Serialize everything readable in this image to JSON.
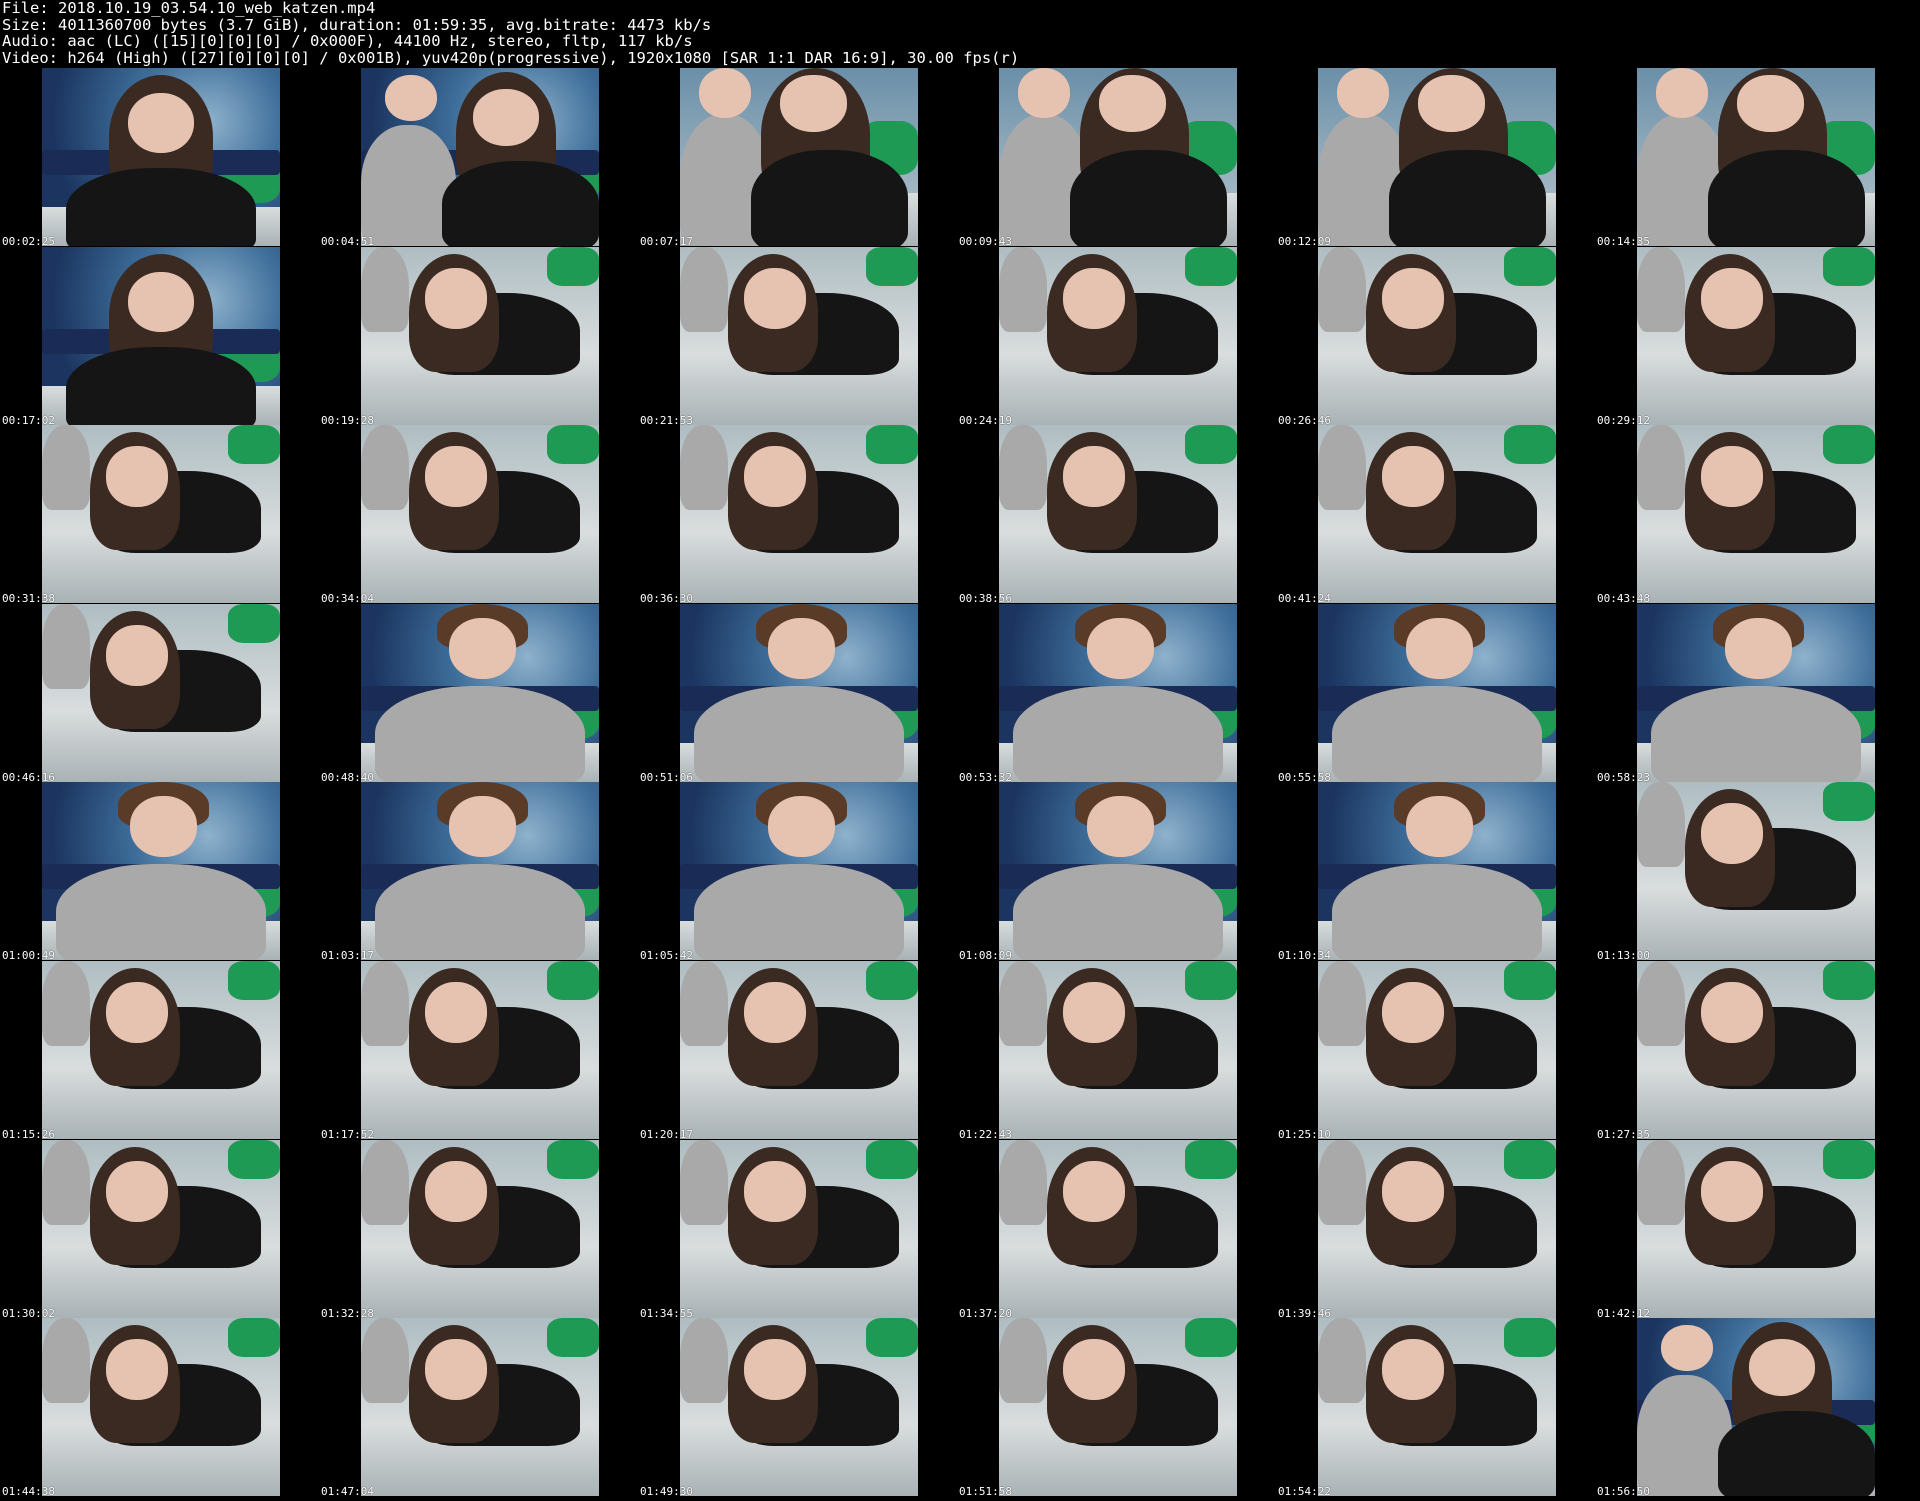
{
  "header": {
    "file": "File: 2018.10.19_03.54.10_web_katzen.mp4",
    "size": "Size: 4011360700 bytes (3.7 GiB), duration: 01:59:35, avg.bitrate: 4473 kb/s",
    "audio": "Audio: aac (LC) ([15][0][0][0] / 0x000F), 44100 Hz, stereo, fltp, 117 kb/s",
    "video": "Video: h264 (High) ([27][0][0][0] / 0x001B), yuv420p(progressive), 1920x1080 [SAR 1:1 DAR 16:9], 30.00 fps(r)"
  },
  "thumbnails": [
    {
      "time": "00:02:25",
      "scene": "sky-girl"
    },
    {
      "time": "00:04:51",
      "scene": "sky-couple"
    },
    {
      "time": "00:07:17",
      "scene": "couple"
    },
    {
      "time": "00:09:43",
      "scene": "couple"
    },
    {
      "time": "00:12:09",
      "scene": "couple"
    },
    {
      "time": "00:14:35",
      "scene": "couple"
    },
    {
      "time": "00:17:02",
      "scene": "sky-girl"
    },
    {
      "time": "00:19:28",
      "scene": "bed-girl"
    },
    {
      "time": "00:21:53",
      "scene": "bed-girl"
    },
    {
      "time": "00:24:19",
      "scene": "bed-girl"
    },
    {
      "time": "00:26:46",
      "scene": "bed-girl"
    },
    {
      "time": "00:29:12",
      "scene": "bed-girl"
    },
    {
      "time": "00:31:38",
      "scene": "bed-girl"
    },
    {
      "time": "00:34:04",
      "scene": "bed-girl"
    },
    {
      "time": "00:36:30",
      "scene": "bed-girl"
    },
    {
      "time": "00:38:56",
      "scene": "bed-girl"
    },
    {
      "time": "00:41:24",
      "scene": "bed-girl"
    },
    {
      "time": "00:43:48",
      "scene": "bed-girl"
    },
    {
      "time": "00:46:16",
      "scene": "bed-girl"
    },
    {
      "time": "00:48:40",
      "scene": "sky-boy"
    },
    {
      "time": "00:51:06",
      "scene": "sky-boy"
    },
    {
      "time": "00:53:32",
      "scene": "sky-boy"
    },
    {
      "time": "00:55:58",
      "scene": "sky-boy"
    },
    {
      "time": "00:58:23",
      "scene": "sky-boy"
    },
    {
      "time": "01:00:49",
      "scene": "sky-boy"
    },
    {
      "time": "01:03:17",
      "scene": "sky-boy"
    },
    {
      "time": "01:05:42",
      "scene": "sky-boy"
    },
    {
      "time": "01:08:09",
      "scene": "sky-boy"
    },
    {
      "time": "01:10:34",
      "scene": "sky-boy"
    },
    {
      "time": "01:13:00",
      "scene": "bed-girl"
    },
    {
      "time": "01:15:26",
      "scene": "bed-girl"
    },
    {
      "time": "01:17:52",
      "scene": "bed-girl"
    },
    {
      "time": "01:20:17",
      "scene": "bed-girl"
    },
    {
      "time": "01:22:43",
      "scene": "bed-girl"
    },
    {
      "time": "01:25:10",
      "scene": "bed-girl"
    },
    {
      "time": "01:27:35",
      "scene": "bed-girl"
    },
    {
      "time": "01:30:02",
      "scene": "bed-girl"
    },
    {
      "time": "01:32:28",
      "scene": "bed-girl"
    },
    {
      "time": "01:34:55",
      "scene": "bed-girl"
    },
    {
      "time": "01:37:20",
      "scene": "bed-girl"
    },
    {
      "time": "01:39:46",
      "scene": "bed-girl"
    },
    {
      "time": "01:42:12",
      "scene": "bed-girl"
    },
    {
      "time": "01:44:38",
      "scene": "bed-girl"
    },
    {
      "time": "01:47:04",
      "scene": "bed-girl"
    },
    {
      "time": "01:49:30",
      "scene": "bed-girl"
    },
    {
      "time": "01:51:58",
      "scene": "bed-girl"
    },
    {
      "time": "01:54:22",
      "scene": "bed-girl"
    },
    {
      "time": "01:56:50",
      "scene": "sky-couple"
    }
  ],
  "colors": {
    "background": "#000000",
    "text": "#ffffff",
    "sky_deep": "#1b3560",
    "sky_mid": "#3f6f9b",
    "sky_light": "#8fb2cc",
    "bed": "#d9ddde",
    "bed_shadow": "#a9b2b5",
    "green": "#1e9a55",
    "shirt_black": "#151515",
    "shirt_gray": "#a9a9aa",
    "hair": "#3a2a22",
    "skin": "#e6c2b1"
  }
}
